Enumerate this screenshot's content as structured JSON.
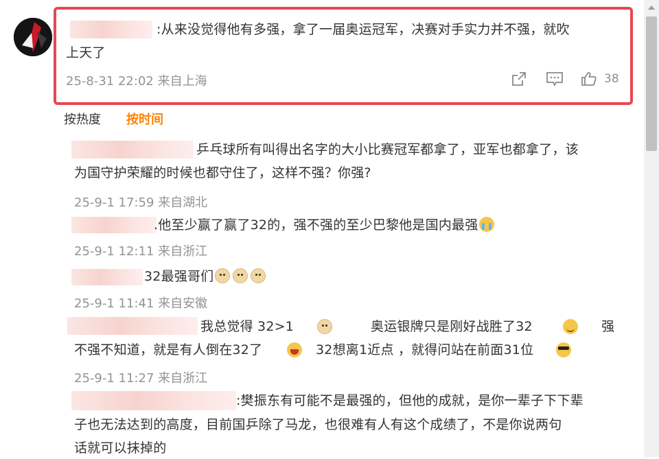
{
  "main_comment": {
    "text_line1": ":从来没觉得他有多强，拿了一届奥运冠军，决赛对手实力并不强，就吹",
    "text_line2": "上天了",
    "meta": "25-8-31 22:02 来自上海",
    "like_count": "38"
  },
  "sort_tabs": {
    "hot": "按热度",
    "time": "按时间"
  },
  "replies": [
    {
      "line1": "乒乓球所有叫得出名字的大小比赛冠军都拿了，亚军也都拿了，该",
      "line2": "为国守护荣耀的时候也都守住了，这样不强？你强?",
      "meta": "25-9-1 17:59 来自湖北"
    },
    {
      "line1": ".他至少赢了赢了32的，强不强的至少巴黎他是国内最强",
      "meta": "25-9-1 12:11 来自浙江"
    },
    {
      "line1": "32最强哥们",
      "meta": "25-9-1 11:41 来自安徽"
    },
    {
      "line1_a": "我总觉得 32>1",
      "line1_b": "奥运银牌只是刚好战胜了32",
      "line1_c": "强",
      "line2_a": "不强不知道，就是有人倒在32了",
      "line2_b": "32想离1近点 ，就得问站在前面31位",
      "meta": "25-9-1 11:27 来自浙江"
    },
    {
      "line1": ":樊振东有可能不是最强的，但他的成就，是你一辈子下下辈",
      "line2": "子也无法达到的高度，目前国乒除了马龙，也很难有人有这个成绩了，不是你说两句",
      "line3": "话就可以抹掉的"
    }
  ],
  "icons": {
    "share": "share-icon",
    "comment": "comment-icon",
    "like": "thumbs-up-icon",
    "doge": "doge-emoji",
    "smile": "smile-emoji",
    "laugh": "laugh-emoji",
    "cool": "sunglasses-emoji",
    "cry": "crying-emoji"
  },
  "colors": {
    "highlight": "#e8474e",
    "active_tab": "#ff8200",
    "meta_text": "#939393"
  }
}
